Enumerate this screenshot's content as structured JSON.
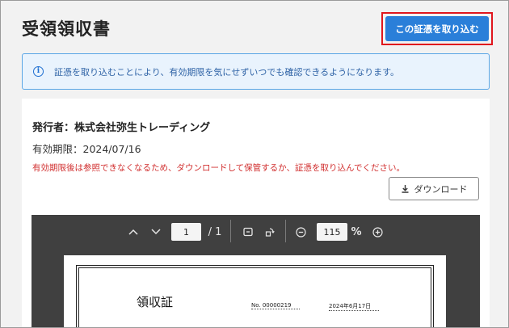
{
  "header": {
    "title": "受領領収書",
    "import_label": "この証憑を取り込む"
  },
  "info": {
    "icon": "info-icon",
    "text": "証憑を取り込むことにより、有効期限を気にせずいつでも確認できるようになります。"
  },
  "document": {
    "issuer": "発行者：株式会社弥生トレーディング",
    "expiry": "有効期限：2024/07/16",
    "warning": "有効期限後は参照できなくなるため、ダウンロードして保管するか、証憑を取り込んでください。",
    "download_label": "ダウンロード"
  },
  "viewer": {
    "page_current": "1",
    "page_total": "/ 1",
    "zoom": "115",
    "zoom_unit": "%",
    "preview": {
      "title": "領収証",
      "number": "No. 00000219",
      "date": "2024年6月17日"
    }
  },
  "colors": {
    "accent": "#2a7fd9",
    "highlight_border": "#e0161d",
    "warning": "#d12f2f",
    "info_bg": "#e9f3fd"
  }
}
